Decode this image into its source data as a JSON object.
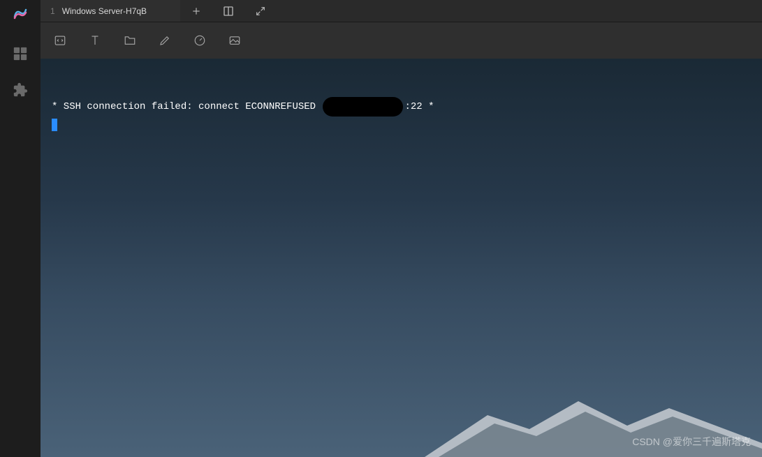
{
  "tab": {
    "index": "1",
    "title": "Windows Server-H7qB"
  },
  "terminal": {
    "line_prefix": "* SSH connection failed: connect ECONNREFUSED ",
    "line_suffix": ":22 *"
  },
  "watermark": "CSDN @爱你三千遍斯塔克"
}
